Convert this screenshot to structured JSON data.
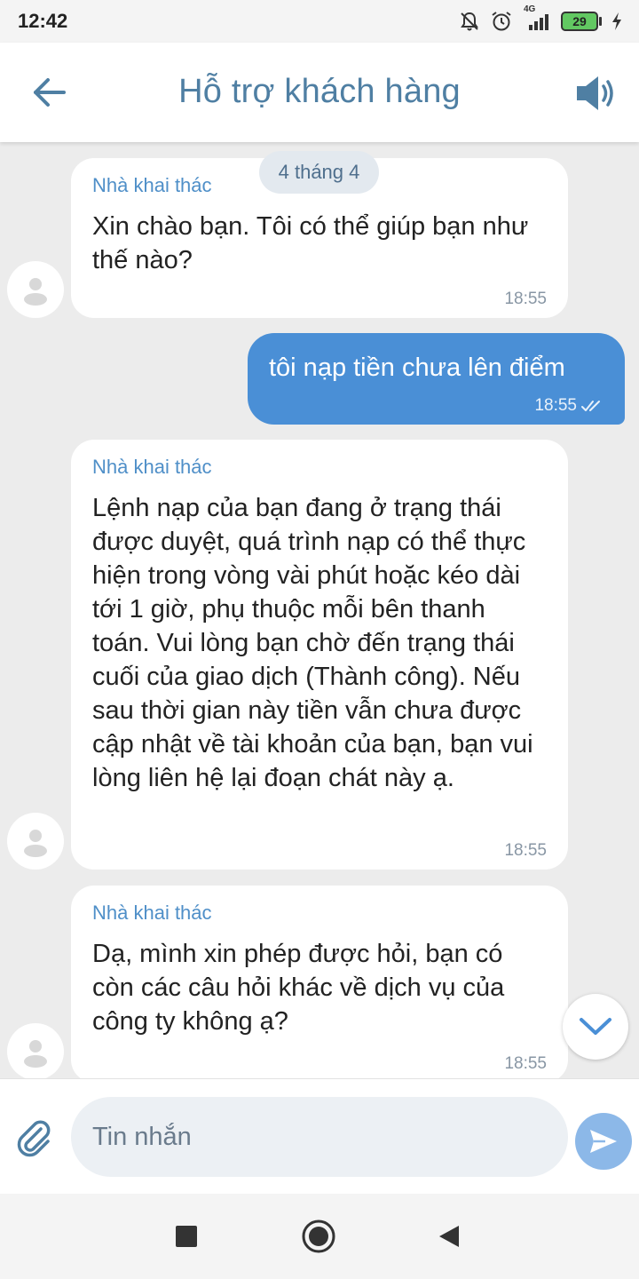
{
  "status_bar": {
    "time": "12:42",
    "network": "4G",
    "battery_level": "29",
    "icons": [
      "bell-off-icon",
      "alarm-icon",
      "signal-icon",
      "battery-icon",
      "charging-icon"
    ]
  },
  "header": {
    "title": "Hỗ trợ khách hàng",
    "back_icon": "arrow-left-icon",
    "sound_icon": "speaker-icon"
  },
  "chat": {
    "date_chip": "4 tháng 4",
    "messages": [
      {
        "direction": "incoming",
        "sender": "Nhà khai thác",
        "text": "Xin chào bạn. Tôi có thể giúp bạn như thế nào?",
        "time": "18:55"
      },
      {
        "direction": "outgoing",
        "text": "tôi nạp tiền chưa lên điểm",
        "time": "18:55",
        "status": "read"
      },
      {
        "direction": "incoming",
        "sender": "Nhà khai thác",
        "text": "Lệnh nạp của bạn đang ở trạng thái được duyệt, quá trình nạp có thể thực hiện trong vòng vài phút hoặc kéo dài tới 1 giờ, phụ thuộc mỗi bên thanh toán. Vui lòng bạn chờ đến trạng thái cuối của giao dịch (Thành công). Nếu sau thời gian này tiền vẫn chưa được cập nhật về tài khoản của bạn, bạn vui lòng liên hệ lại đoạn chát này ạ.",
        "time": "18:55"
      },
      {
        "direction": "incoming",
        "sender": "Nhà khai thác",
        "text": "Dạ, mình xin phép được hỏi, bạn có còn các câu hỏi khác về dịch vụ của công ty không ạ?",
        "time": "18:55"
      }
    ]
  },
  "composer": {
    "placeholder": "Tin nhắn",
    "value": "",
    "attach_icon": "paperclip-icon",
    "send_icon": "send-icon"
  },
  "nav": {
    "icons": [
      "recents-square-icon",
      "home-circle-icon",
      "back-triangle-icon"
    ]
  },
  "colors": {
    "accent": "#4a8fd6",
    "title": "#4f7fa3",
    "sender": "#4f8fc8",
    "background": "#ececec"
  }
}
